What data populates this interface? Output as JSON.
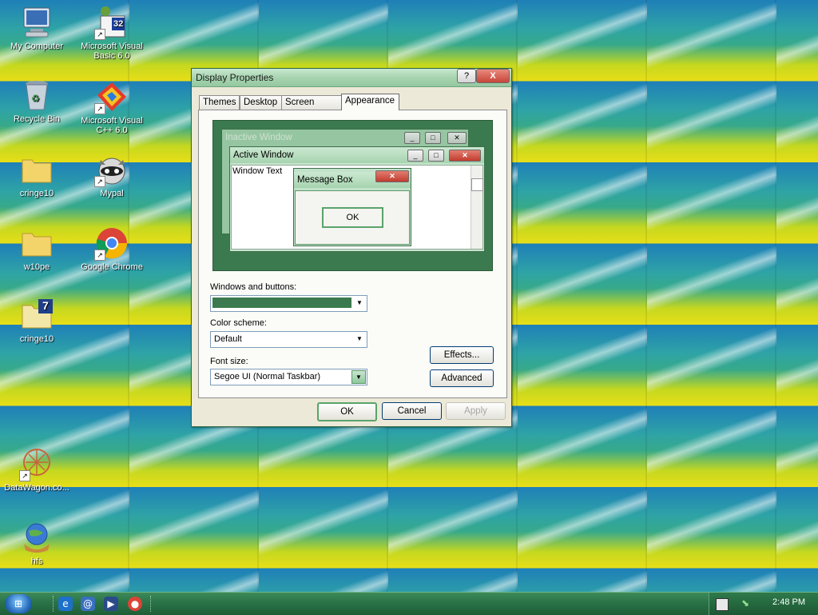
{
  "desktop": {
    "icons": [
      {
        "label": "My Computer",
        "icon": "computer-icon"
      },
      {
        "label": "Microsoft Visual Basic 6.0",
        "badge": "32",
        "icon": "vb6-icon"
      },
      {
        "label": "Recycle Bin",
        "icon": "recycle-bin-icon"
      },
      {
        "label": "Microsoft Visual C++ 6.0",
        "icon": "vc6-icon"
      },
      {
        "label": "cringe10",
        "icon": "folder-icon"
      },
      {
        "label": "Mypal",
        "icon": "mypal-icon"
      },
      {
        "label": "w10pe",
        "icon": "folder-icon"
      },
      {
        "label": "Google Chrome",
        "icon": "chrome-icon"
      },
      {
        "label": "cringe10",
        "badge": "7",
        "icon": "folder-icon"
      },
      {
        "label": "DataWagon.co...",
        "icon": "datawagon-icon"
      },
      {
        "label": "hfs",
        "icon": "hfs-icon"
      }
    ],
    "shortcut_arrow": "↗"
  },
  "dialog": {
    "title": "Display Properties",
    "help_button": "?",
    "close_button": "X",
    "tabs": [
      "Themes",
      "Desktop",
      "Screen Saver",
      "Appearance"
    ],
    "active_tab": "Appearance",
    "preview": {
      "inactive_title": "Inactive Window",
      "active_title": "Active Window",
      "window_text": "Window Text",
      "message_title": "Message Box",
      "ok": "OK"
    },
    "windows_buttons_label": "Windows and buttons:",
    "windows_buttons_value": "",
    "color_scheme_label": "Color scheme:",
    "color_scheme_value": "Default",
    "font_size_label": "Font size:",
    "font_size_value": "Segoe UI (Normal Taskbar)",
    "effects_button": "Effects...",
    "advanced_button": "Advanced",
    "ok_button": "OK",
    "cancel_button": "Cancel",
    "apply_button": "Apply"
  },
  "taskbar": {
    "start_label": "⊞",
    "clock": "2:48 PM"
  },
  "colors": {
    "theme_green": "#3b7a4f",
    "title_green": "#a7d4b0"
  }
}
